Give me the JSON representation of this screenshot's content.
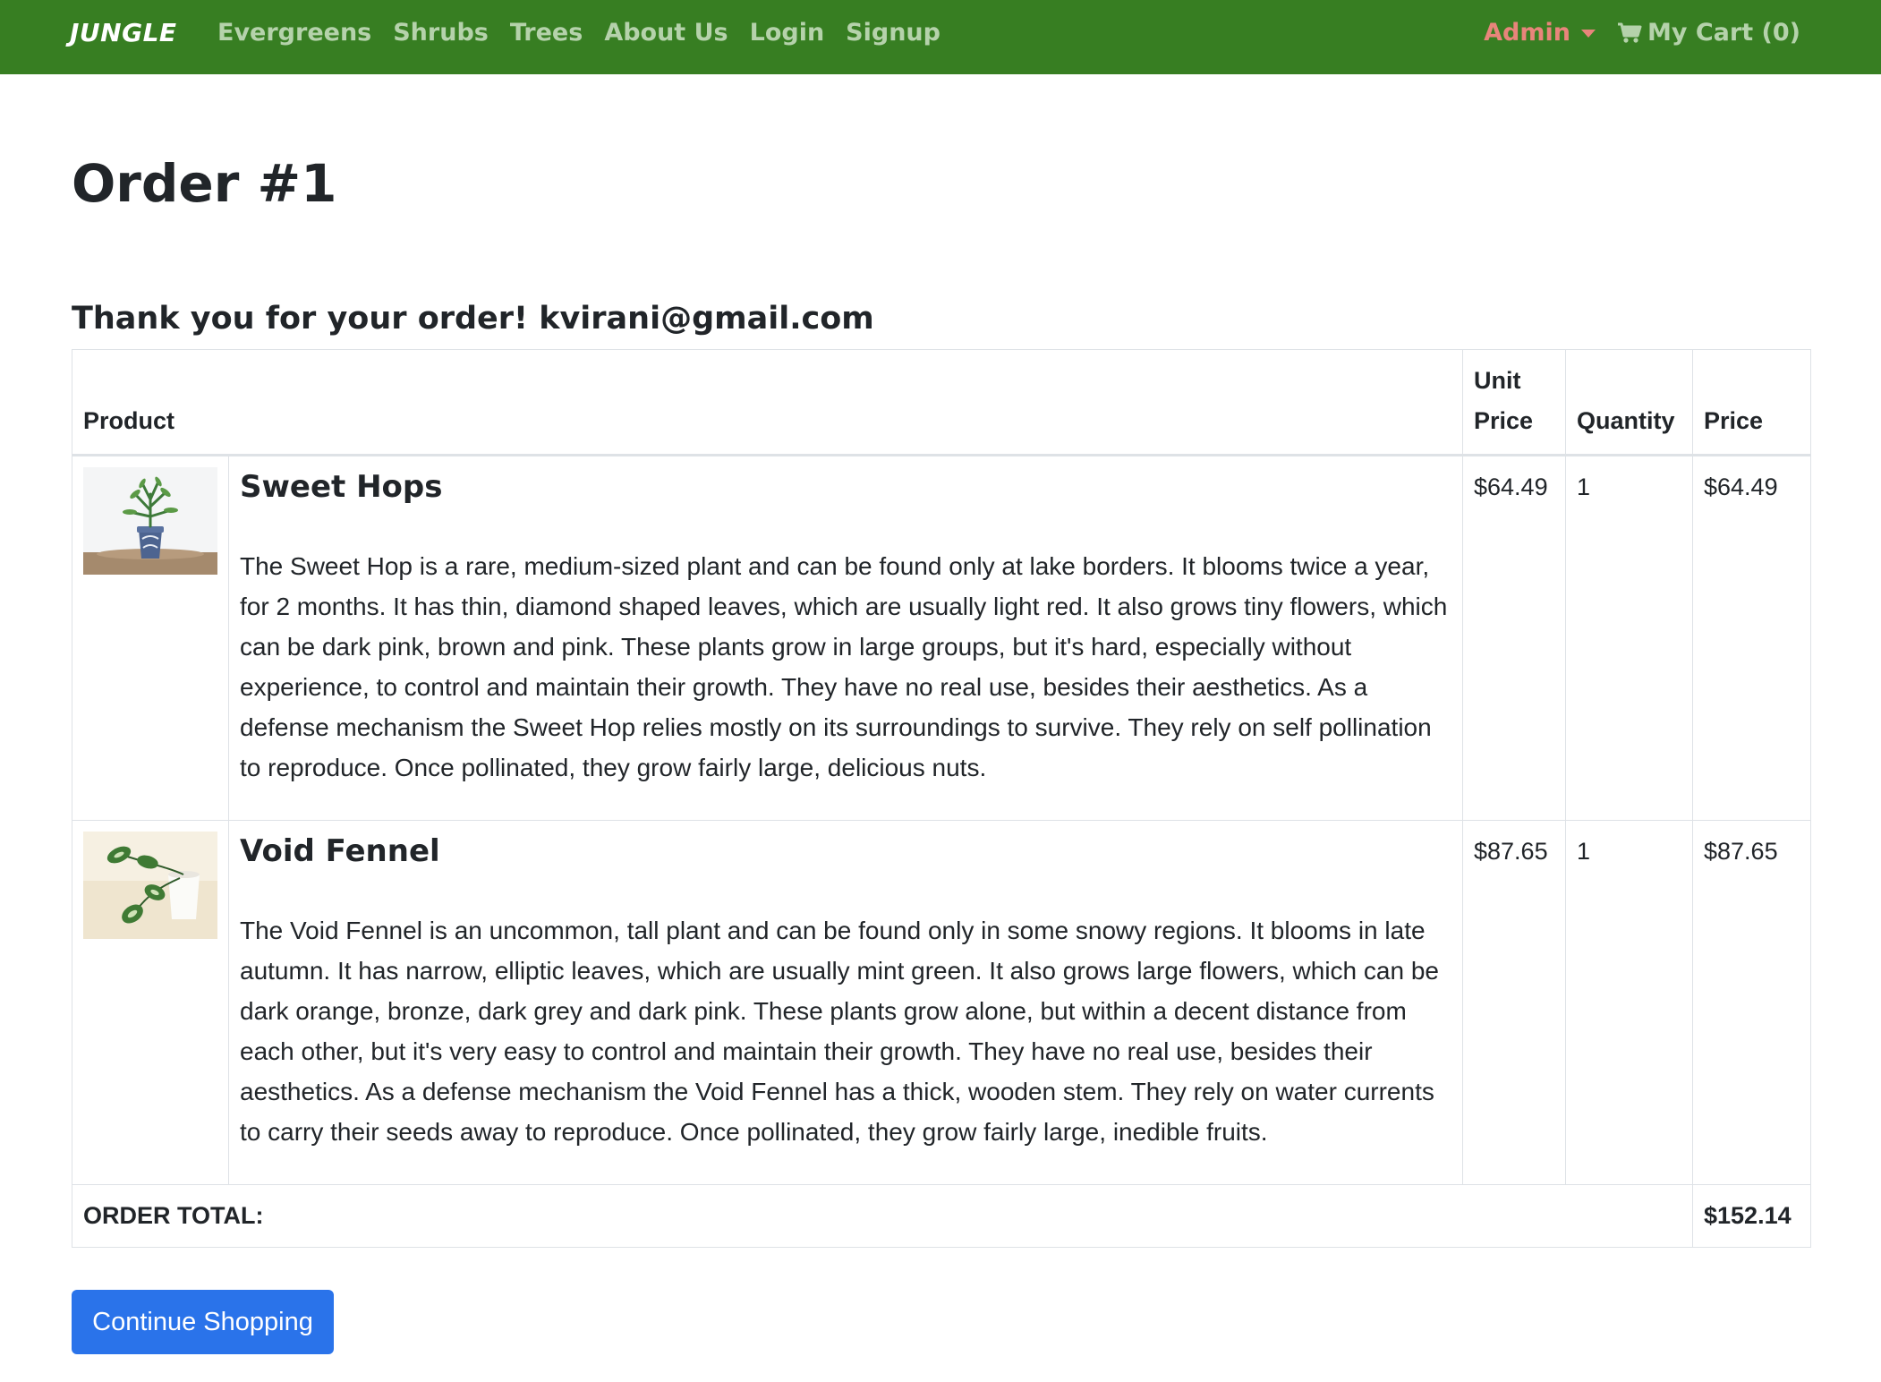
{
  "navbar": {
    "brand": "JUNGLE",
    "links": [
      "Evergreens",
      "Shrubs",
      "Trees",
      "About Us",
      "Login",
      "Signup"
    ],
    "admin_label": "Admin",
    "cart_label": "My Cart (0)"
  },
  "page": {
    "title": "Order #1",
    "thanks_prefix": "Thank you for your order!",
    "email": "kvirani@gmail.com"
  },
  "table": {
    "headers": {
      "product": "Product",
      "unit_price_line1": "Unit",
      "unit_price_line2": "Price",
      "quantity": "Quantity",
      "price": "Price"
    },
    "rows": [
      {
        "name": "Sweet Hops",
        "image_icon": "potted-plant-thumbnail",
        "description": "The Sweet Hop is a rare, medium-sized plant and can be found only at lake borders. It blooms twice a year, for 2 months. It has thin, diamond shaped leaves, which are usually light red. It also grows tiny flowers, which can be dark pink, brown and pink. These plants grow in large groups, but it's hard, especially without experience, to control and maintain their growth. They have no real use, besides their aesthetics. As a defense mechanism the Sweet Hop relies mostly on its surroundings to survive. They rely on self pollination to reproduce. Once pollinated, they grow fairly large, delicious nuts.",
        "unit_price": "$64.49",
        "quantity": "1",
        "price": "$64.49"
      },
      {
        "name": "Void Fennel",
        "image_icon": "vine-plant-thumbnail",
        "description": "The Void Fennel is an uncommon, tall plant and can be found only in some snowy regions. It blooms in late autumn. It has narrow, elliptic leaves, which are usually mint green. It also grows large flowers, which can be dark orange, bronze, dark grey and dark pink. These plants grow alone, but within a decent distance from each other, but it's very easy to control and maintain their growth. They have no real use, besides their aesthetics. As a defense mechanism the Void Fennel has a thick, wooden stem. They rely on water currents to carry their seeds away to reproduce. Once pollinated, they grow fairly large, inedible fruits.",
        "unit_price": "$87.65",
        "quantity": "1",
        "price": "$87.65"
      }
    ],
    "total_label": "ORDER TOTAL:",
    "total_value": "$152.14"
  },
  "actions": {
    "continue_label": "Continue Shopping"
  },
  "colors": {
    "navbar_bg": "#377e22",
    "nav_link": "#b5d2ab",
    "admin": "#e8857b",
    "button_bg": "#2a73ea"
  }
}
